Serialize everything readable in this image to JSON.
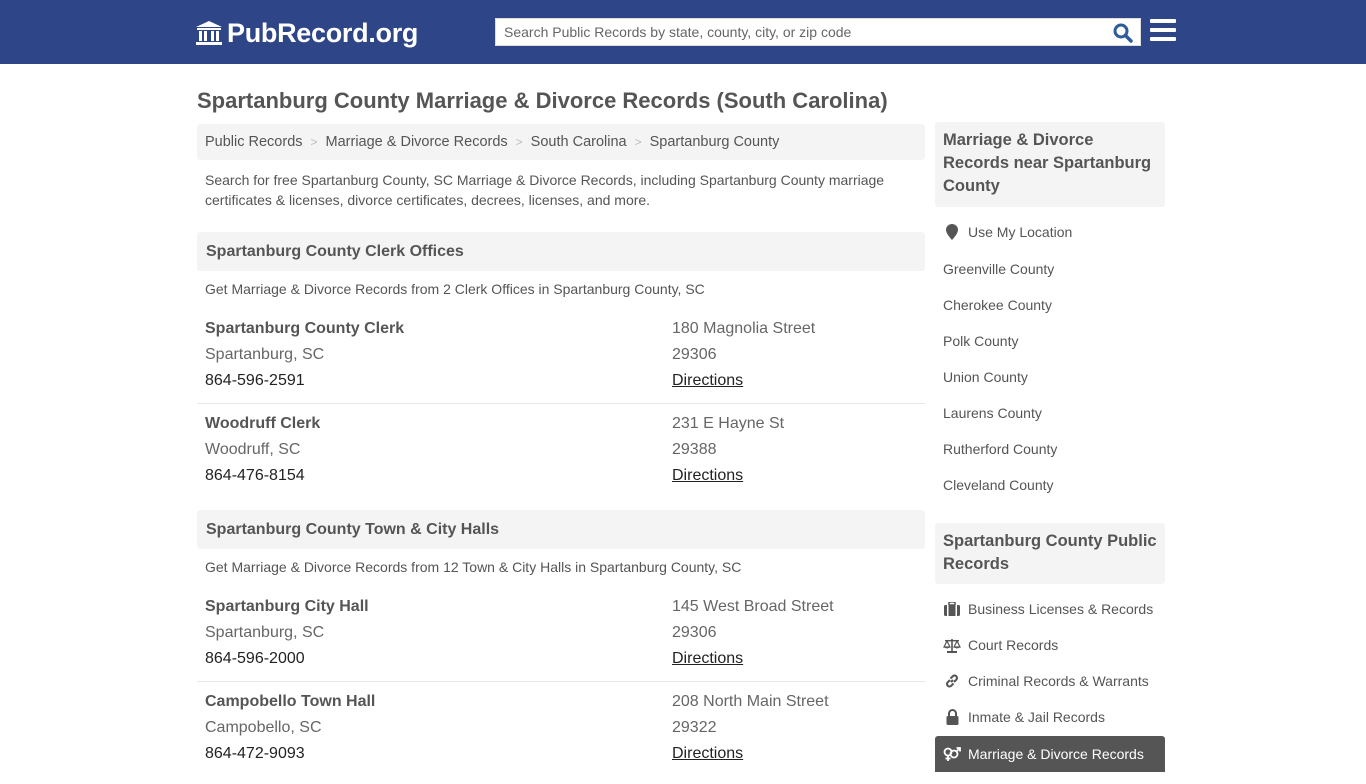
{
  "header": {
    "logo_text": "PubRecord.org",
    "search_placeholder": "Search Public Records by state, county, city, or zip code",
    "brand_color": "#2e4588"
  },
  "page_title": "Spartanburg County Marriage & Divorce Records (South Carolina)",
  "breadcrumb": [
    "Public Records",
    "Marriage & Divorce Records",
    "South Carolina",
    "Spartanburg County"
  ],
  "intro": "Search for free Spartanburg County, SC Marriage & Divorce Records, including Spartanburg County marriage certificates & licenses, divorce certificates, decrees, licenses, and more.",
  "sections": [
    {
      "title": "Spartanburg County Clerk Offices",
      "description": "Get Marriage & Divorce Records from 2 Clerk Offices in Spartanburg County, SC",
      "entries": [
        {
          "name": "Spartanburg County Clerk",
          "city": "Spartanburg, SC",
          "phone": "864-596-2591",
          "address": "180 Magnolia Street",
          "zip": "29306",
          "directions": "Directions"
        },
        {
          "name": "Woodruff Clerk",
          "city": "Woodruff, SC",
          "phone": "864-476-8154",
          "address": "231 E Hayne St",
          "zip": "29388",
          "directions": "Directions"
        }
      ]
    },
    {
      "title": "Spartanburg County Town & City Halls",
      "description": "Get Marriage & Divorce Records from 12 Town & City Halls in Spartanburg County, SC",
      "entries": [
        {
          "name": "Spartanburg City Hall",
          "city": "Spartanburg, SC",
          "phone": "864-596-2000",
          "address": "145 West Broad Street",
          "zip": "29306",
          "directions": "Directions"
        },
        {
          "name": "Campobello Town Hall",
          "city": "Campobello, SC",
          "phone": "864-472-9093",
          "address": "208 North Main Street",
          "zip": "29322",
          "directions": "Directions"
        }
      ]
    }
  ],
  "sidebar": {
    "nearby_title": "Marriage & Divorce Records near Spartanburg County",
    "use_location": "Use My Location",
    "nearby": [
      "Greenville County",
      "Cherokee County",
      "Polk County",
      "Union County",
      "Laurens County",
      "Rutherford County",
      "Cleveland County"
    ],
    "public_title": "Spartanburg County Public Records",
    "public_links": [
      {
        "label": "Business Licenses & Records",
        "icon": "briefcase-icon"
      },
      {
        "label": "Court Records",
        "icon": "balance-scale-icon"
      },
      {
        "label": "Criminal Records & Warrants",
        "icon": "link-icon"
      },
      {
        "label": "Inmate & Jail Records",
        "icon": "lock-icon"
      },
      {
        "label": "Marriage & Divorce Records",
        "icon": "venus-mars-icon",
        "active": true
      }
    ]
  }
}
